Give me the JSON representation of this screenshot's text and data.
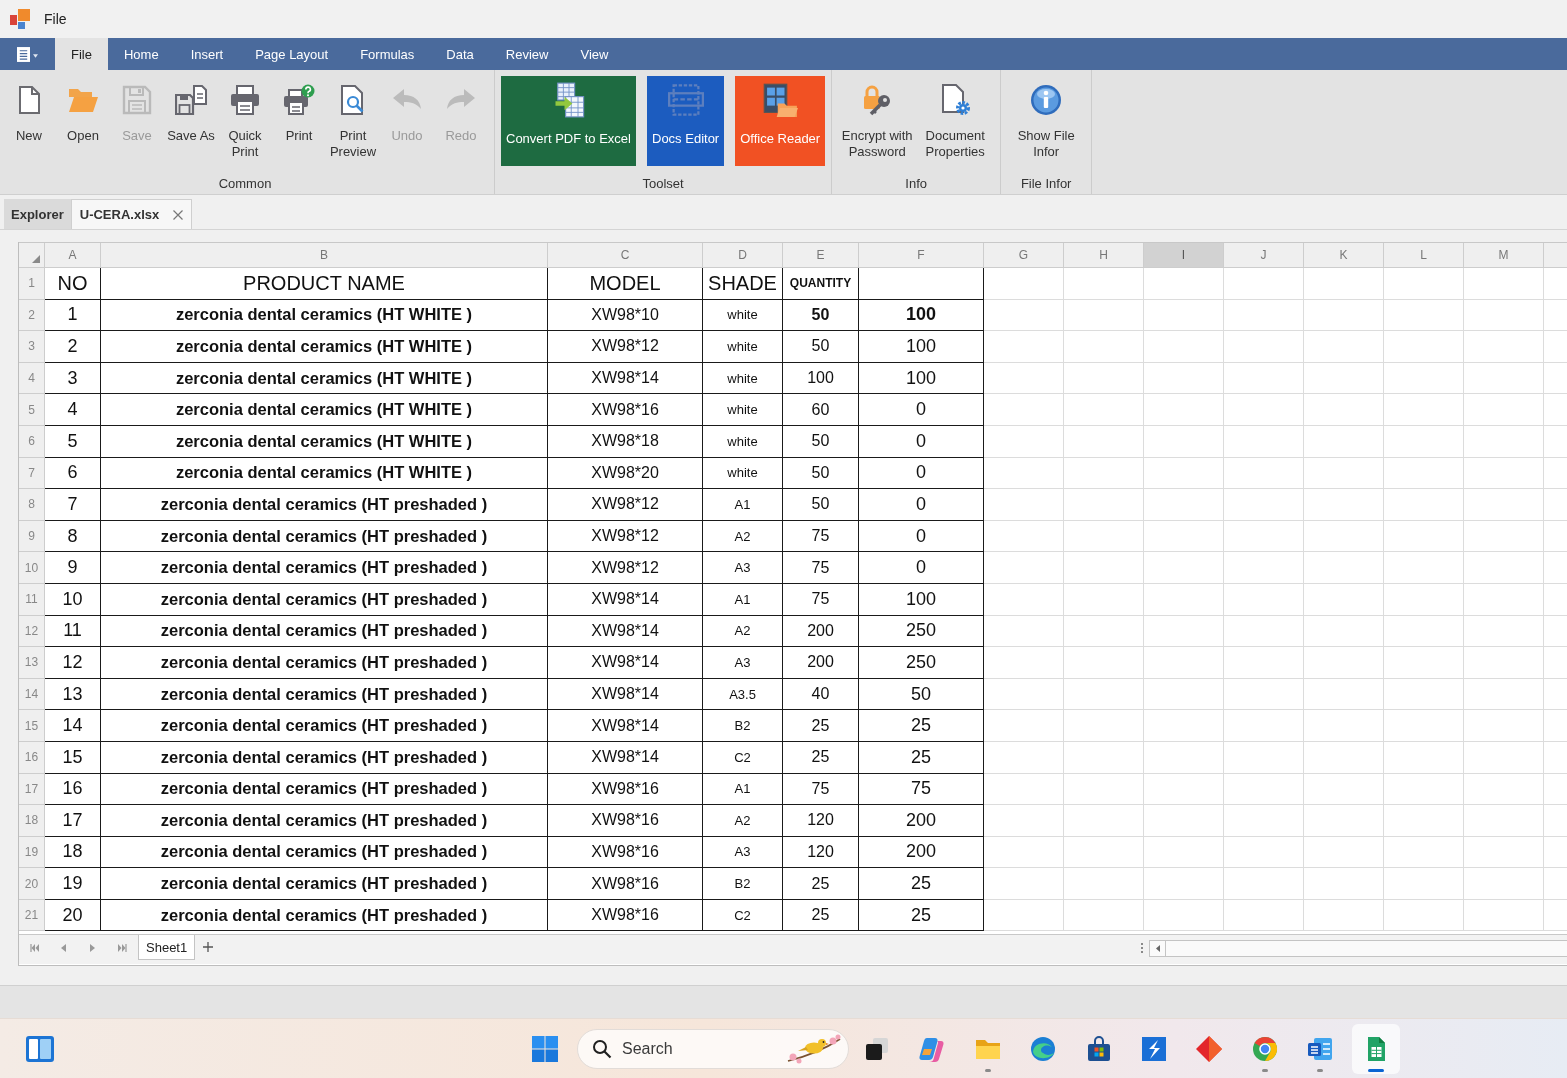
{
  "app": {
    "title": "File"
  },
  "menu_tabs": [
    {
      "label": "File",
      "selected": true
    },
    {
      "label": "Home",
      "selected": false
    },
    {
      "label": "Insert",
      "selected": false
    },
    {
      "label": "Page Layout",
      "selected": false
    },
    {
      "label": "Formulas",
      "selected": false
    },
    {
      "label": "Data",
      "selected": false
    },
    {
      "label": "Review",
      "selected": false
    },
    {
      "label": "View",
      "selected": false
    }
  ],
  "ribbon": {
    "groups": [
      {
        "label": "Common",
        "kind": "buttons",
        "items": [
          {
            "label": "New",
            "disabled": false
          },
          {
            "label": "Open",
            "disabled": false
          },
          {
            "label": "Save",
            "disabled": true
          },
          {
            "label": "Save As",
            "disabled": false
          },
          {
            "label": "Quick Print",
            "disabled": false
          },
          {
            "label": "Print",
            "disabled": false
          },
          {
            "label": "Print Preview",
            "disabled": false
          },
          {
            "label": "Undo",
            "disabled": true
          },
          {
            "label": "Redo",
            "disabled": true
          }
        ]
      },
      {
        "label": "Toolset",
        "kind": "tiles",
        "items": [
          {
            "label": "Convert PDF to Excel",
            "color": "#1e6b41",
            "disabled": false
          },
          {
            "label": "Docs Editor",
            "color": "#1c5cbf",
            "disabled": false
          },
          {
            "label": "Office Reader",
            "color": "#f15123",
            "disabled": false
          }
        ]
      },
      {
        "label": "Info",
        "kind": "buttons",
        "items": [
          {
            "label": "Encrypt with Password",
            "disabled": false
          },
          {
            "label": "Document Properties",
            "disabled": false
          }
        ]
      },
      {
        "label": "File Infor",
        "kind": "buttons",
        "items": [
          {
            "label": "Show File Infor",
            "disabled": false
          }
        ]
      }
    ]
  },
  "document_tabs": [
    {
      "label": "Explorer",
      "selected": false
    },
    {
      "label": "U-CERA.xlsx",
      "selected": true
    }
  ],
  "sheet": {
    "columns": [
      {
        "label": "A",
        "selected": false
      },
      {
        "label": "B",
        "selected": false
      },
      {
        "label": "C",
        "selected": false
      },
      {
        "label": "D",
        "selected": false
      },
      {
        "label": "E",
        "selected": false
      },
      {
        "label": "F",
        "selected": false
      },
      {
        "label": "G",
        "selected": false
      },
      {
        "label": "H",
        "selected": false
      },
      {
        "label": "I",
        "selected": true
      },
      {
        "label": "J",
        "selected": false
      },
      {
        "label": "K",
        "selected": false
      },
      {
        "label": "L",
        "selected": false
      },
      {
        "label": "M",
        "selected": false
      }
    ],
    "header_row": {
      "number": "1",
      "no": "NO",
      "product": "PRODUCT NAME",
      "model": "MODEL",
      "shade": "SHADE",
      "quantity": "QUANTITY"
    },
    "rows": [
      {
        "number": "2",
        "no": "1",
        "product": "zerconia dental ceramics (HT WHITE )",
        "model": "XW98*10",
        "shade": "white",
        "quantity": "50",
        "column_f": "100",
        "quantities_bold": true
      },
      {
        "number": "3",
        "no": "2",
        "product": "zerconia dental ceramics (HT WHITE )",
        "model": "XW98*12",
        "shade": "white",
        "quantity": "50",
        "column_f": "100",
        "quantities_bold": false
      },
      {
        "number": "4",
        "no": "3",
        "product": "zerconia dental ceramics (HT WHITE )",
        "model": "XW98*14",
        "shade": "white",
        "quantity": "100",
        "column_f": "100",
        "quantities_bold": false
      },
      {
        "number": "5",
        "no": "4",
        "product": "zerconia dental ceramics (HT WHITE )",
        "model": "XW98*16",
        "shade": "white",
        "quantity": "60",
        "column_f": "0",
        "quantities_bold": false
      },
      {
        "number": "6",
        "no": "5",
        "product": "zerconia dental ceramics (HT WHITE )",
        "model": "XW98*18",
        "shade": "white",
        "quantity": "50",
        "column_f": "0",
        "quantities_bold": false
      },
      {
        "number": "7",
        "no": "6",
        "product": "zerconia dental ceramics (HT WHITE )",
        "model": "XW98*20",
        "shade": "white",
        "quantity": "50",
        "column_f": "0",
        "quantities_bold": false
      },
      {
        "number": "8",
        "no": "7",
        "product": "zerconia dental ceramics (HT preshaded )",
        "model": "XW98*12",
        "shade": "A1",
        "quantity": "50",
        "column_f": "0",
        "quantities_bold": false
      },
      {
        "number": "9",
        "no": "8",
        "product": "zerconia dental ceramics (HT preshaded )",
        "model": "XW98*12",
        "shade": "A2",
        "quantity": "75",
        "column_f": "0",
        "quantities_bold": false
      },
      {
        "number": "10",
        "no": "9",
        "product": "zerconia dental ceramics (HT preshaded )",
        "model": "XW98*12",
        "shade": "A3",
        "quantity": "75",
        "column_f": "0",
        "quantities_bold": false
      },
      {
        "number": "11",
        "no": "10",
        "product": "zerconia dental ceramics (HT preshaded )",
        "model": "XW98*14",
        "shade": "A1",
        "quantity": "75",
        "column_f": "100",
        "quantities_bold": false
      },
      {
        "number": "12",
        "no": "11",
        "product": "zerconia dental ceramics (HT preshaded )",
        "model": "XW98*14",
        "shade": "A2",
        "quantity": "200",
        "column_f": "250",
        "quantities_bold": false
      },
      {
        "number": "13",
        "no": "12",
        "product": "zerconia dental ceramics (HT preshaded )",
        "model": "XW98*14",
        "shade": "A3",
        "quantity": "200",
        "column_f": "250",
        "quantities_bold": false
      },
      {
        "number": "14",
        "no": "13",
        "product": "zerconia dental ceramics (HT preshaded )",
        "model": "XW98*14",
        "shade": "A3.5",
        "quantity": "40",
        "column_f": "50",
        "quantities_bold": false
      },
      {
        "number": "15",
        "no": "14",
        "product": "zerconia dental ceramics (HT preshaded )",
        "model": "XW98*14",
        "shade": "B2",
        "quantity": "25",
        "column_f": "25",
        "quantities_bold": false
      },
      {
        "number": "16",
        "no": "15",
        "product": "zerconia dental ceramics (HT preshaded )",
        "model": "XW98*14",
        "shade": "C2",
        "quantity": "25",
        "column_f": "25",
        "quantities_bold": false
      },
      {
        "number": "17",
        "no": "16",
        "product": "zerconia dental ceramics (HT preshaded )",
        "model": "XW98*16",
        "shade": "A1",
        "quantity": "75",
        "column_f": "75",
        "quantities_bold": false
      },
      {
        "number": "18",
        "no": "17",
        "product": "zerconia dental ceramics (HT preshaded )",
        "model": "XW98*16",
        "shade": "A2",
        "quantity": "120",
        "column_f": "200",
        "quantities_bold": false
      },
      {
        "number": "19",
        "no": "18",
        "product": "zerconia dental ceramics (HT preshaded )",
        "model": "XW98*16",
        "shade": "A3",
        "quantity": "120",
        "column_f": "200",
        "quantities_bold": false
      },
      {
        "number": "20",
        "no": "19",
        "product": "zerconia dental ceramics (HT preshaded )",
        "model": "XW98*16",
        "shade": "B2",
        "quantity": "25",
        "column_f": "25",
        "quantities_bold": false
      },
      {
        "number": "21",
        "no": "20",
        "product": "zerconia dental ceramics (HT preshaded )",
        "model": "XW98*16",
        "shade": "C2",
        "quantity": "25",
        "column_f": "25",
        "quantities_bold": false
      }
    ]
  },
  "sheet_tabs": [
    {
      "label": "Sheet1",
      "selected": true
    }
  ],
  "taskbar": {
    "search": {
      "placeholder": "Search"
    },
    "apps": [
      {
        "running": false,
        "selected": false
      },
      {
        "running": false,
        "selected": false
      },
      {
        "running": true,
        "selected": false
      },
      {
        "running": false,
        "selected": false
      },
      {
        "running": false,
        "selected": false
      },
      {
        "running": false,
        "selected": false
      },
      {
        "running": false,
        "selected": false
      },
      {
        "running": true,
        "selected": false
      },
      {
        "running": true,
        "selected": false
      },
      {
        "running": true,
        "selected": true
      }
    ]
  }
}
